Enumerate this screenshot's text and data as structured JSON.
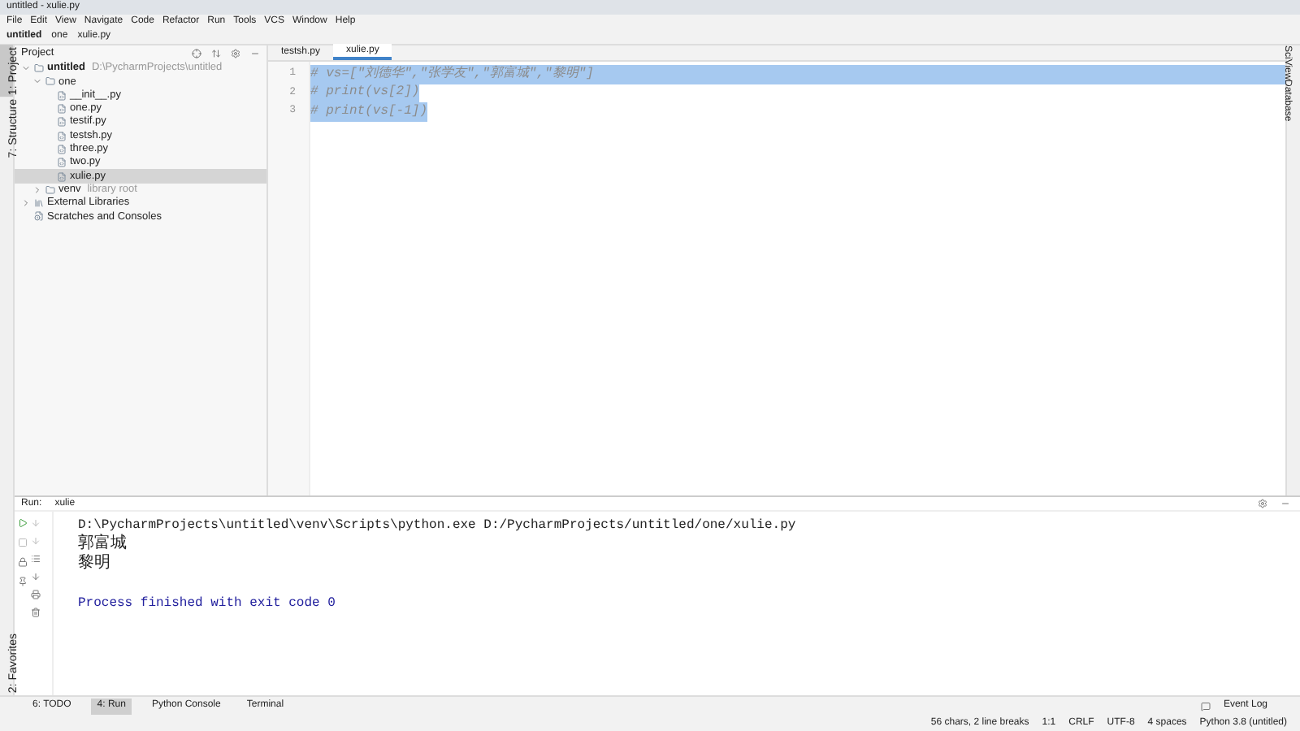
{
  "window": {
    "title": "untitled - xulie.py"
  },
  "menu": [
    "File",
    "Edit",
    "View",
    "Navigate",
    "Code",
    "Refactor",
    "Run",
    "Tools",
    "VCS",
    "Window",
    "Help"
  ],
  "breadcrumb": [
    "untitled",
    "one",
    "xulie.py"
  ],
  "left_strip": {
    "top": [
      {
        "label": "1: Project",
        "selected": true
      },
      {
        "label": "7: Structure",
        "selected": false
      }
    ],
    "bottom": [
      {
        "label": "2: Favorites",
        "selected": false
      }
    ]
  },
  "right_strip": [
    "SciView",
    "Database"
  ],
  "project_panel": {
    "title": "Project",
    "tree": [
      {
        "name": "untitled",
        "path": "D:\\PycharmProjects\\untitled",
        "kind": "folder",
        "expanded": true,
        "children": [
          {
            "name": "one",
            "kind": "folder",
            "expanded": true,
            "children": [
              {
                "name": "__init__.py",
                "kind": "file",
                "selected": false
              },
              {
                "name": "one.py",
                "kind": "file",
                "selected": false
              },
              {
                "name": "testif.py",
                "kind": "file",
                "selected": false
              },
              {
                "name": "testsh.py",
                "kind": "file",
                "selected": false
              },
              {
                "name": "three.py",
                "kind": "file",
                "selected": false
              },
              {
                "name": "two.py",
                "kind": "file",
                "selected": false
              },
              {
                "name": "xulie.py",
                "kind": "file",
                "selected": true
              }
            ]
          },
          {
            "name": "venv",
            "path": "library root",
            "kind": "folder",
            "expanded": false
          }
        ]
      },
      {
        "name": "External Libraries",
        "kind": "library",
        "expanded": false
      },
      {
        "name": "Scratches and Consoles",
        "kind": "scratch"
      }
    ]
  },
  "editor": {
    "tabs": [
      {
        "label": "testsh.py",
        "selected": false
      },
      {
        "label": "xulie.py",
        "selected": true
      }
    ],
    "lines": [
      {
        "number": "1",
        "text": "# vs=[\"刘德华\",\"张学友\",\"郭富城\",\"黎明\"]",
        "selected": true
      },
      {
        "number": "2",
        "text": "# print(vs[2])",
        "selected": true
      },
      {
        "number": "3",
        "text": "# print(vs[-1])",
        "selected": true
      }
    ]
  },
  "run_panel": {
    "label": "Run:",
    "tab": "xulie",
    "output": [
      {
        "kind": "command",
        "text": "D:\\PycharmProjects\\untitled\\venv\\Scripts\\python.exe D:/PycharmProjects/untitled/one/xulie.py"
      },
      {
        "kind": "text",
        "text": "郭富城"
      },
      {
        "kind": "text",
        "text": "黎明"
      },
      {
        "kind": "status",
        "text": "Process finished with exit code 0"
      }
    ]
  },
  "tool_tabs": [
    {
      "label": "6: TODO",
      "selected": false
    },
    {
      "label": "4: Run",
      "selected": true
    },
    {
      "label": "Python Console",
      "selected": false
    },
    {
      "label": "Terminal",
      "selected": false
    }
  ],
  "event_log": "Event Log",
  "status_bar": [
    "56 chars, 2 line breaks",
    "1:1",
    "CRLF",
    "UTF-8",
    "4 spaces",
    "Python 3.8 (untitled)"
  ]
}
